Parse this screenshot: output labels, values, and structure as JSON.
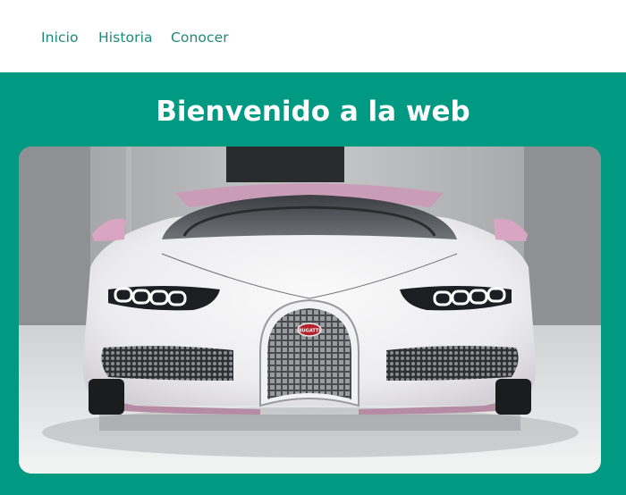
{
  "nav": {
    "items": [
      "Inicio",
      "Historia",
      "Conocer"
    ]
  },
  "hero": {
    "title": "Bienvenido a la web",
    "image_alt": "Bugatti Chiron blanco y rosa",
    "badge": "BUGATTI"
  },
  "colors": {
    "brand": "#009a83",
    "nav_text": "#1b8a78",
    "title_text": "#ffffff"
  }
}
